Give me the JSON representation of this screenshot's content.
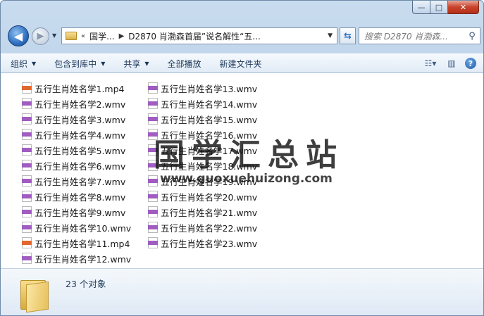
{
  "window": {
    "caption_buttons": {
      "minimize": "—",
      "maximize": "□",
      "close": "✕"
    }
  },
  "nav": {
    "back_icon": "arrow-left-icon",
    "forward_icon": "arrow-right-icon",
    "address": {
      "prefix": "«",
      "crumb1": "国学...",
      "crumb2": "D2870 肖渤森首届”说名解性“五..."
    },
    "search_placeholder": "搜索 D2870 肖渤森..."
  },
  "toolbar": {
    "organize": "组织",
    "include_library": "包含到库中",
    "share": "共享",
    "play_all": "全部播放",
    "new_folder": "新建文件夹"
  },
  "files": {
    "col1": [
      {
        "name": "五行生肖姓名学1.mp4",
        "type": "mp4"
      },
      {
        "name": "五行生肖姓名学2.wmv",
        "type": "wmv"
      },
      {
        "name": "五行生肖姓名学3.wmv",
        "type": "wmv"
      },
      {
        "name": "五行生肖姓名学4.wmv",
        "type": "wmv"
      },
      {
        "name": "五行生肖姓名学5.wmv",
        "type": "wmv"
      },
      {
        "name": "五行生肖姓名学6.wmv",
        "type": "wmv"
      },
      {
        "name": "五行生肖姓名学7.wmv",
        "type": "wmv"
      },
      {
        "name": "五行生肖姓名学8.wmv",
        "type": "wmv"
      },
      {
        "name": "五行生肖姓名学9.wmv",
        "type": "wmv"
      },
      {
        "name": "五行生肖姓名学10.wmv",
        "type": "wmv"
      },
      {
        "name": "五行生肖姓名学11.mp4",
        "type": "mp4"
      },
      {
        "name": "五行生肖姓名学12.wmv",
        "type": "wmv"
      }
    ],
    "col2": [
      {
        "name": "五行生肖姓名学13.wmv",
        "type": "wmv"
      },
      {
        "name": "五行生肖姓名学14.wmv",
        "type": "wmv"
      },
      {
        "name": "五行生肖姓名学15.wmv",
        "type": "wmv"
      },
      {
        "name": "五行生肖姓名学16.wmv",
        "type": "wmv"
      },
      {
        "name": "五行生肖姓名学17.wmv",
        "type": "wmv"
      },
      {
        "name": "五行生肖姓名学18.wmv",
        "type": "wmv"
      },
      {
        "name": "五行生肖姓名学19.wmv",
        "type": "wmv"
      },
      {
        "name": "五行生肖姓名学20.wmv",
        "type": "wmv"
      },
      {
        "name": "五行生肖姓名学21.wmv",
        "type": "wmv"
      },
      {
        "name": "五行生肖姓名学22.wmv",
        "type": "wmv"
      },
      {
        "name": "五行生肖姓名学23.wmv",
        "type": "wmv"
      }
    ]
  },
  "watermark": {
    "cn": "国学汇总站",
    "en": "www.guoxuehuizong.com"
  },
  "status": {
    "count": "23 个对象"
  }
}
